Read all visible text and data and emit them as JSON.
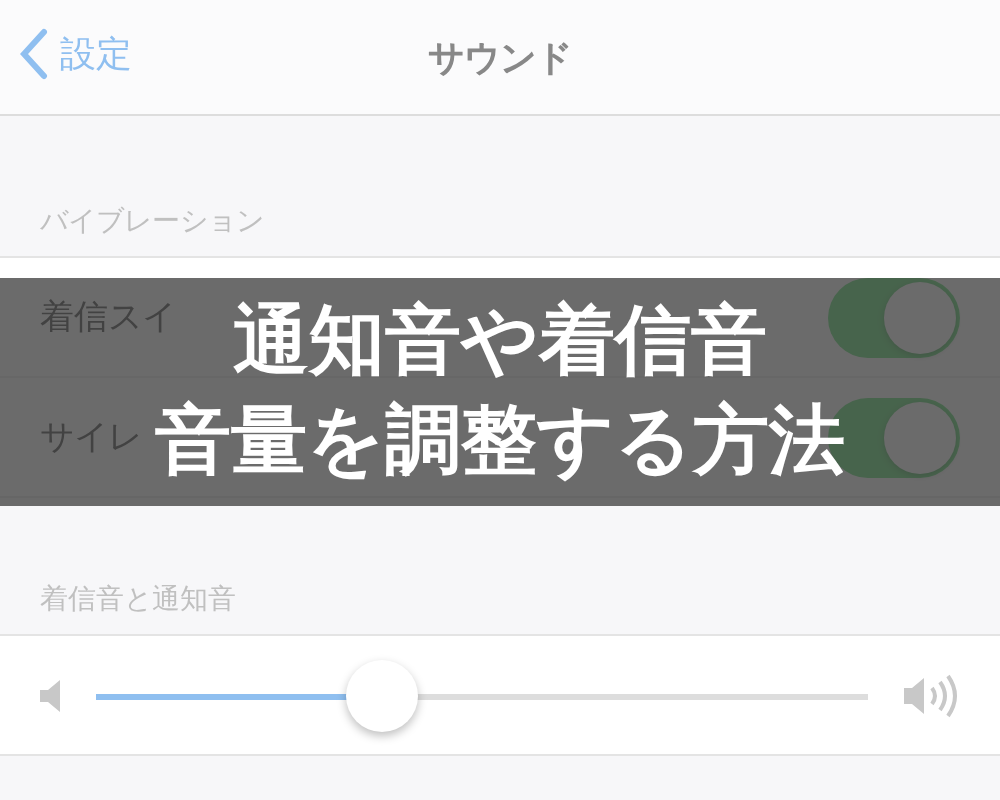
{
  "nav": {
    "back": "設定",
    "title": "サウンド"
  },
  "sections": [
    {
      "header": "バイブレーション",
      "rows": [
        {
          "kind": "toggle",
          "label": "着信スイ",
          "on": true
        },
        {
          "kind": "toggle",
          "label": "サイレ",
          "on": true
        }
      ]
    },
    {
      "header": "着信音と通知音",
      "rows": [
        {
          "kind": "slider",
          "level": 0.37
        }
      ]
    }
  ],
  "banner": {
    "lines": [
      "通知音や着信音",
      "音量を調整する方法"
    ]
  }
}
